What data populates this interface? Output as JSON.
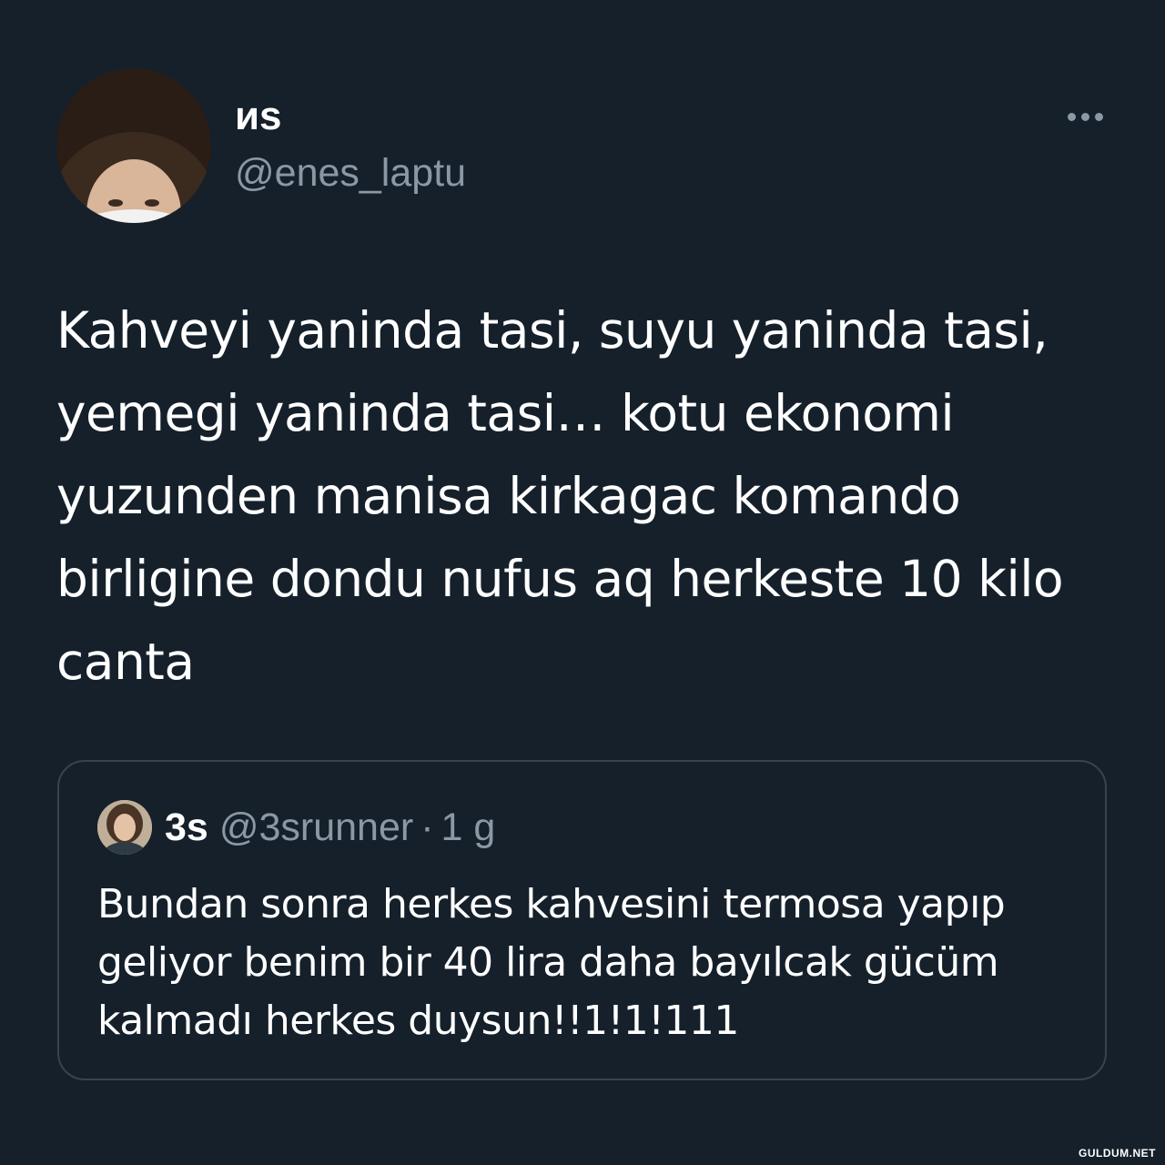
{
  "author": {
    "display_name": "иѕ",
    "handle": "@enes_laptu",
    "avatar_icon": "profile-photo-avatar"
  },
  "more_icon": "more-horizontal-icon",
  "tweet_text": "Kahveyi yaninda tasi, suyu yaninda tasi, yemegi yaninda tasi… kotu ekonomi yuzunden manisa kirkagac komando birligine dondu nufus aq herkeste 10 kilo canta",
  "quoted_tweet": {
    "display_name": "3s",
    "handle": "@3srunner",
    "separator": "·",
    "time": "1 g",
    "text": "Bundan sonra herkes kahvesini termosa yapıp geliyor benim bir 40 lira daha bayılcak gücüm kalmadı herkes duysun!!1!1!111"
  },
  "watermark": "GULDUM.NET",
  "colors": {
    "background": "#15202b",
    "text_primary": "#ffffff",
    "text_secondary": "#8b98a5",
    "border": "#38444d"
  }
}
